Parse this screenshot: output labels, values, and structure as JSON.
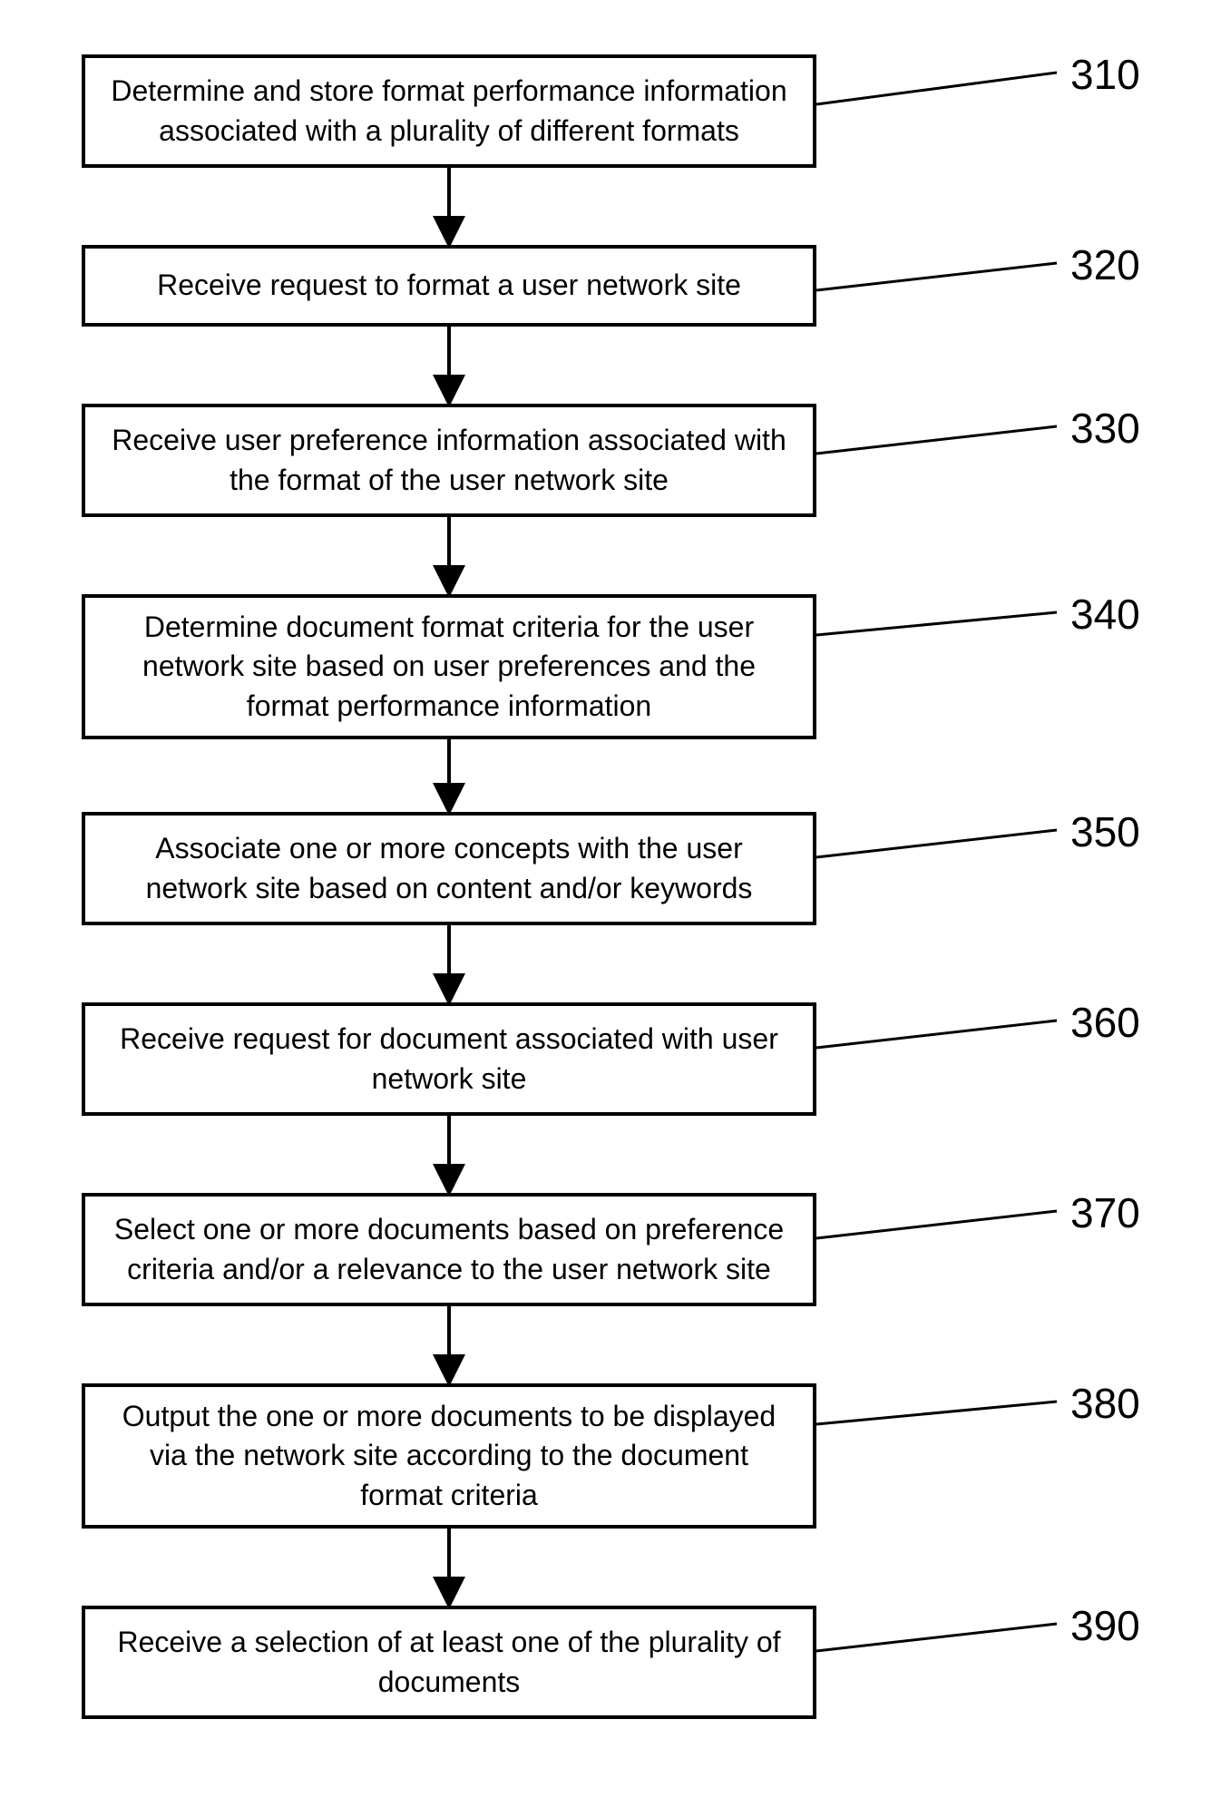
{
  "steps": [
    {
      "ref": "310",
      "text": "Determine and store format performance information associated with a plurality of different formats"
    },
    {
      "ref": "320",
      "text": "Receive request to format a user network site"
    },
    {
      "ref": "330",
      "text": "Receive user preference information associated with the format of the user network site"
    },
    {
      "ref": "340",
      "text": "Determine document format criteria for the user network site based on user preferences and the format performance information"
    },
    {
      "ref": "350",
      "text": "Associate one or more concepts with the user network site based on content and/or keywords"
    },
    {
      "ref": "360",
      "text": "Receive request for document associated with user network site"
    },
    {
      "ref": "370",
      "text": "Select one or more documents based on preference criteria and/or a relevance to the user network site"
    },
    {
      "ref": "380",
      "text": "Output the one or more documents to be displayed via the network site according to the document format criteria"
    },
    {
      "ref": "390",
      "text": "Receive a selection of at least one of the plurality of documents"
    }
  ]
}
